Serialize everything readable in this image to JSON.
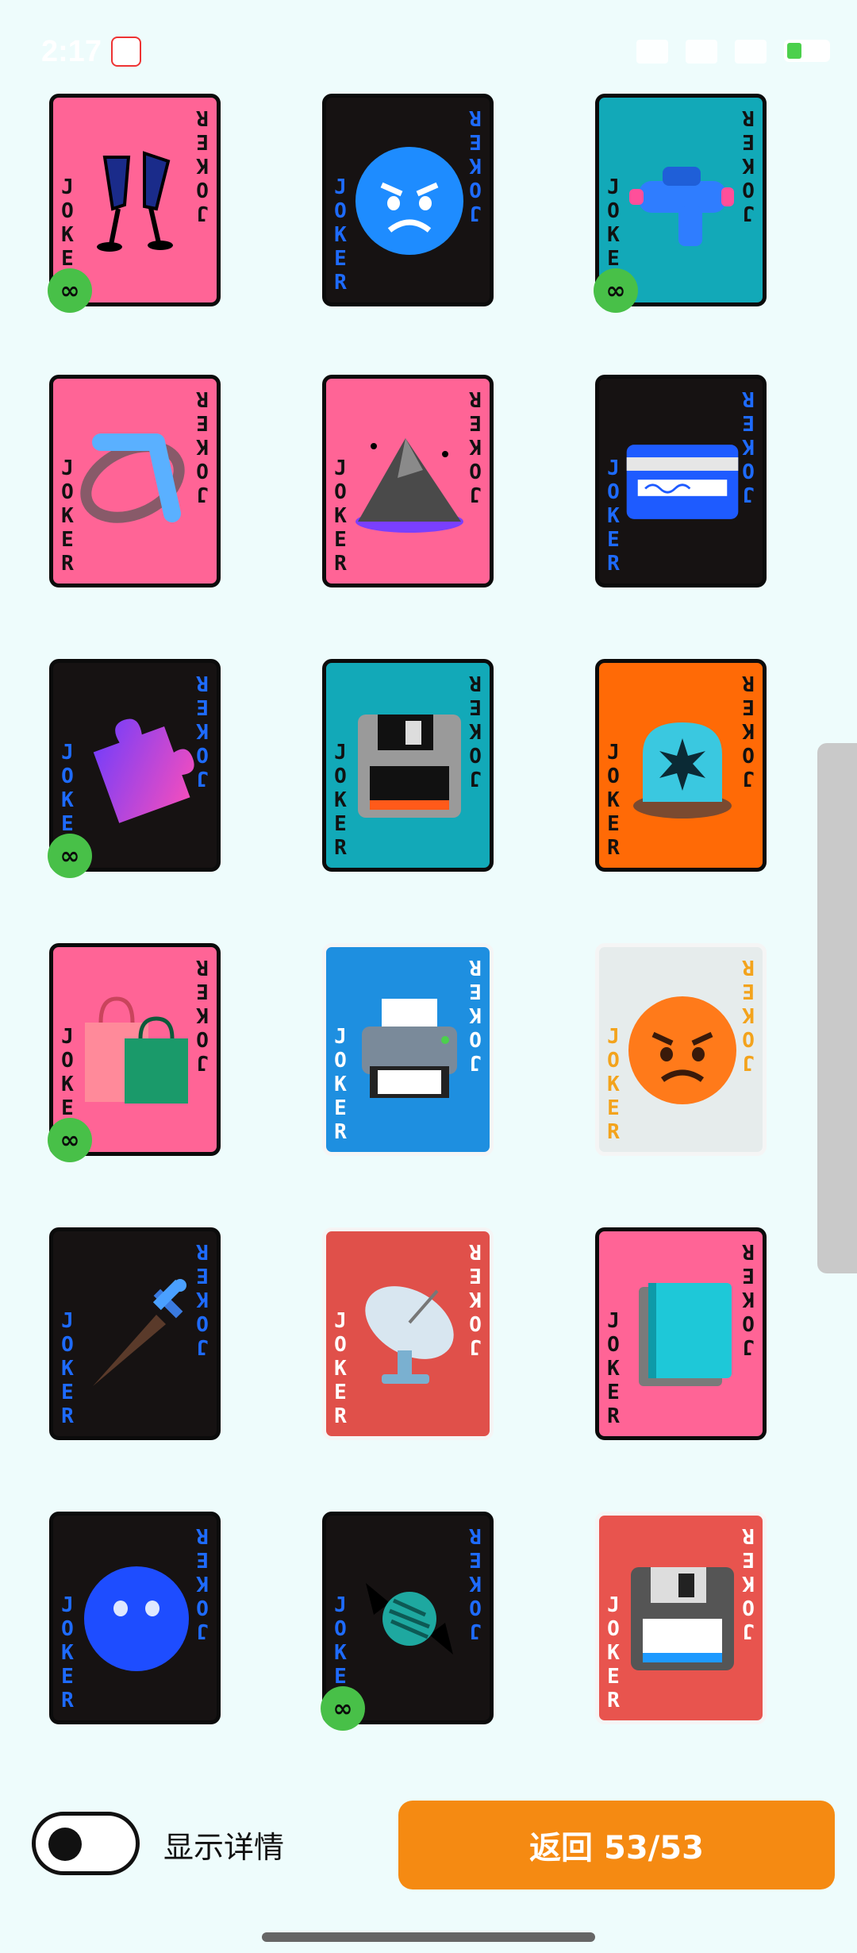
{
  "status_bar": {
    "time": "2:17",
    "icons": [
      "vibrate-icon",
      "signal-icon",
      "wifi-icon",
      "battery-icon"
    ]
  },
  "cards": [
    {
      "bg": "#ff6496",
      "text_color": "#111111",
      "art": "champagne-glasses",
      "infinite": true
    },
    {
      "bg": "#161212",
      "text_color": "#1e6bff",
      "art": "angry-blue-face",
      "infinite": false
    },
    {
      "bg": "#12a9b8",
      "text_color": "#111111",
      "art": "water-pistol",
      "infinite": true
    },
    {
      "bg": "#ff6496",
      "text_color": "#111111",
      "art": "boomerang",
      "infinite": false
    },
    {
      "bg": "#ff6496",
      "text_color": "#111111",
      "art": "mountain",
      "infinite": false
    },
    {
      "bg": "#161212",
      "text_color": "#1e6bff",
      "art": "credit-card",
      "infinite": false
    },
    {
      "bg": "#161212",
      "text_color": "#1e6bff",
      "art": "puzzle-piece",
      "infinite": true
    },
    {
      "bg": "#12a9b8",
      "text_color": "#111111",
      "art": "floppy-disk",
      "infinite": false
    },
    {
      "bg": "#ff6a06",
      "text_color": "#111111",
      "art": "siren-light",
      "infinite": false
    },
    {
      "bg": "#ff6496",
      "text_color": "#111111",
      "art": "shopping-bags",
      "infinite": true
    },
    {
      "bg": "#1e8fe0",
      "text_color": "#ffffff",
      "art": "printer",
      "infinite": false
    },
    {
      "bg": "#e6ecec",
      "text_color": "#f3a31c",
      "art": "angry-face",
      "infinite": false
    },
    {
      "bg": "#161212",
      "text_color": "#1e6bff",
      "art": "dagger",
      "infinite": false
    },
    {
      "bg": "#e0504a",
      "text_color": "#ffffff",
      "art": "satellite-dish",
      "infinite": false
    },
    {
      "bg": "#ff6496",
      "text_color": "#111111",
      "art": "book",
      "infinite": false
    },
    {
      "bg": "#161212",
      "text_color": "#1e6bff",
      "art": "blue-blob",
      "infinite": false
    },
    {
      "bg": "#161212",
      "text_color": "#1e6bff",
      "art": "candy",
      "infinite": true
    },
    {
      "bg": "#e8544e",
      "text_color": "#ffffff",
      "art": "floppy-disk-white",
      "infinite": false
    }
  ],
  "joker_text": "JOKER",
  "infinite_symbol": "∞",
  "bottom": {
    "toggle_label": "显示详情",
    "toggle_on": false,
    "back_button_label": "返回 53/53"
  }
}
